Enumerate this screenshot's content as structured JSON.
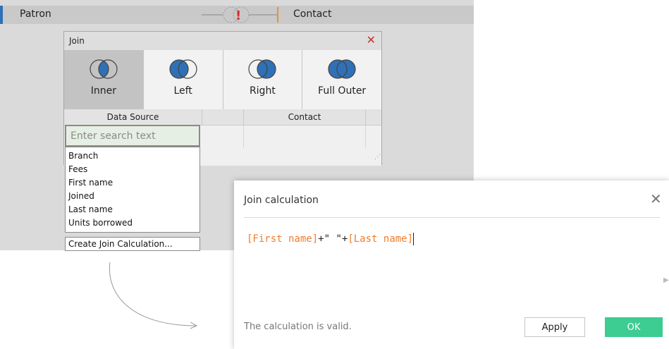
{
  "canvas": {
    "left_table": "Patron",
    "right_table": "Contact"
  },
  "join_dialog": {
    "title": "Join",
    "join_types": [
      {
        "label": "Inner",
        "icon": "inner-join-icon",
        "selected": true
      },
      {
        "label": "Left",
        "icon": "left-join-icon",
        "selected": false
      },
      {
        "label": "Right",
        "icon": "right-join-icon",
        "selected": false
      },
      {
        "label": "Full Outer",
        "icon": "full-outer-join-icon",
        "selected": false
      }
    ],
    "columns": [
      "Data Source",
      "Contact"
    ],
    "search_placeholder": "Enter search text",
    "fields": [
      "Branch",
      "Fees",
      "First name",
      "Joined",
      "Last name",
      "Units borrowed"
    ],
    "create_calc_label": "Create Join Calculation..."
  },
  "calc_dialog": {
    "title": "Join calculation",
    "formula": {
      "field1": "[First name]",
      "operator": "+\" \"+",
      "field2": "[Last name]"
    },
    "status": "The calculation is valid.",
    "apply_label": "Apply",
    "ok_label": "OK"
  },
  "colors": {
    "accent_blue": "#2f70b6",
    "venn_fill": "#2f70b6",
    "field_orange": "#ef7d2c",
    "ok_green": "#3dcc91",
    "error_red": "#d62c2c"
  }
}
